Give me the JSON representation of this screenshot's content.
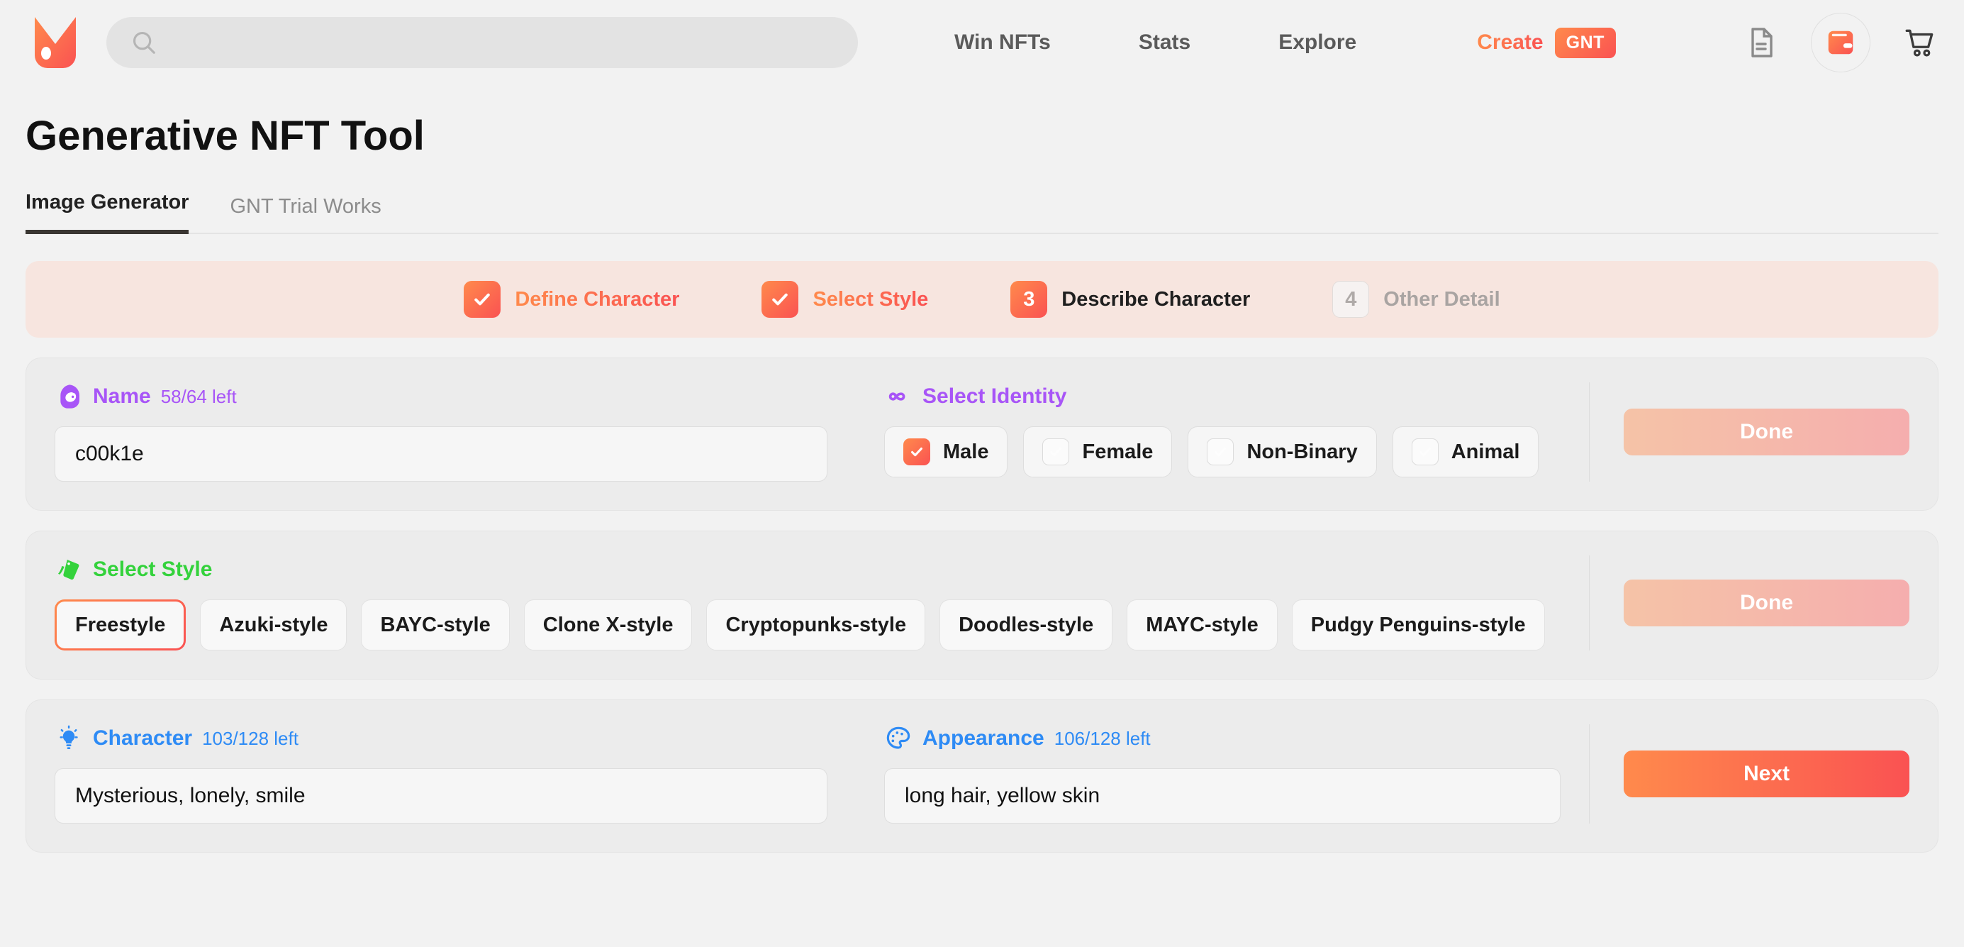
{
  "header": {
    "logo_icon": "fox-logo-icon",
    "search": {
      "value": "",
      "placeholder": "",
      "icon": "search-icon"
    },
    "nav": [
      {
        "label": "Win NFTs"
      },
      {
        "label": "Stats"
      },
      {
        "label": "Explore"
      }
    ],
    "create": {
      "label": "Create",
      "badge": "GNT"
    },
    "icons": [
      {
        "name": "document-icon"
      },
      {
        "name": "wallet-icon"
      },
      {
        "name": "cart-icon"
      }
    ]
  },
  "page": {
    "title": "Generative NFT Tool",
    "tabs": [
      {
        "label": "Image Generator",
        "active": true
      },
      {
        "label": "GNT Trial Works",
        "active": false
      }
    ]
  },
  "stepper": {
    "steps": [
      {
        "marker": "✓",
        "label": "Define Character",
        "state": "done"
      },
      {
        "marker": "✓",
        "label": "Select Style",
        "state": "done"
      },
      {
        "marker": "3",
        "label": "Describe Character",
        "state": "current"
      },
      {
        "marker": "4",
        "label": "Other Detail",
        "state": "todo"
      }
    ]
  },
  "cards": {
    "define_character": {
      "name_field": {
        "icon": "avatar-icon",
        "title": "Name",
        "count": "58/64 left",
        "value": "c00k1e",
        "placeholder": ""
      },
      "identity": {
        "icon": "infinity-icon",
        "title": "Select Identity",
        "options": [
          {
            "label": "Male",
            "checked": true
          },
          {
            "label": "Female",
            "checked": false
          },
          {
            "label": "Non-Binary",
            "checked": false
          },
          {
            "label": "Animal",
            "checked": false
          }
        ]
      },
      "action": {
        "label": "Done",
        "disabled": true
      }
    },
    "select_style": {
      "icon": "tag-icon",
      "title": "Select Style",
      "options": [
        {
          "label": "Freestyle",
          "selected": true
        },
        {
          "label": "Azuki-style",
          "selected": false
        },
        {
          "label": "BAYC-style",
          "selected": false
        },
        {
          "label": "Clone X-style",
          "selected": false
        },
        {
          "label": "Cryptopunks-style",
          "selected": false
        },
        {
          "label": "Doodles-style",
          "selected": false
        },
        {
          "label": "MAYC-style",
          "selected": false
        },
        {
          "label": "Pudgy Penguins-style",
          "selected": false
        }
      ],
      "action": {
        "label": "Done",
        "disabled": true
      }
    },
    "describe_character": {
      "character_field": {
        "icon": "lightbulb-icon",
        "title": "Character",
        "count": "103/128 left",
        "value": "Mysterious, lonely, smile",
        "placeholder": ""
      },
      "appearance_field": {
        "icon": "palette-icon",
        "title": "Appearance",
        "count": "106/128 left",
        "value": "long hair, yellow skin",
        "placeholder": ""
      },
      "action": {
        "label": "Next",
        "disabled": false
      }
    }
  },
  "colors": {
    "accent_start": "#FF8A4C",
    "accent_end": "#FA5252",
    "purple": "#A855F7",
    "green": "#34D23C",
    "blue": "#2E8BF5",
    "page_bg": "#F2F2F2",
    "card_bg": "#ECECEC",
    "stepper_bg": "#F7E5DF"
  }
}
